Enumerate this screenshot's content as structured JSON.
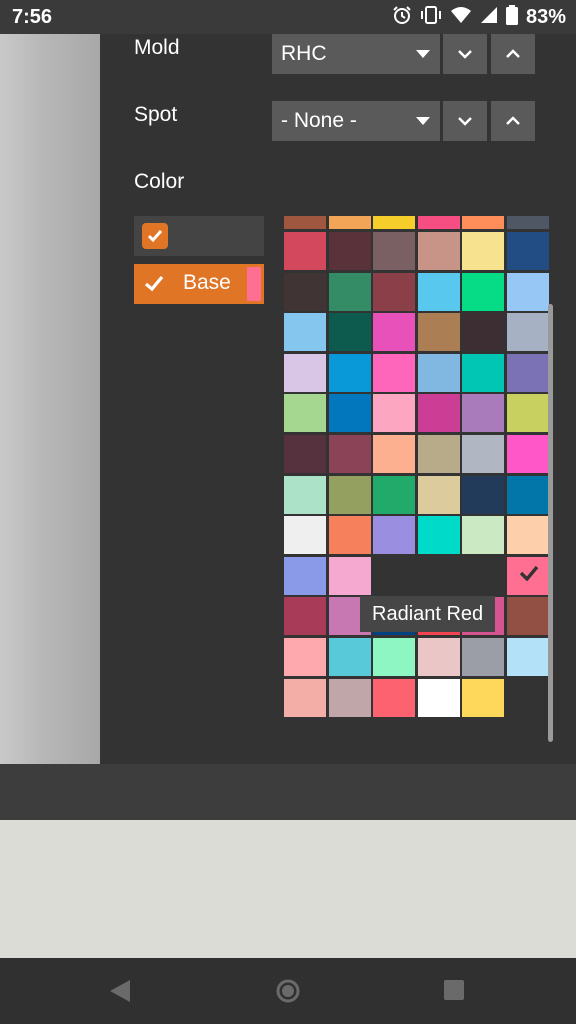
{
  "status_bar": {
    "time": "7:56",
    "battery_percent": "83%",
    "icons": [
      "alarm-icon",
      "vibrate-icon",
      "wifi-icon",
      "signal-icon",
      "battery-icon"
    ]
  },
  "controls": {
    "mold": {
      "label": "Mold",
      "value": "RHC"
    },
    "spot": {
      "label": "Spot",
      "value": "- None -"
    },
    "color": {
      "label": "Color"
    }
  },
  "layers": [
    {
      "label": "",
      "checked": true,
      "swatch_color": ""
    },
    {
      "label": "Base",
      "checked": true,
      "swatch_color": "#ff6f91"
    }
  ],
  "palette": {
    "partial_top_row": [
      "#a0573f",
      "#f2a556",
      "#f6ce2b",
      "#f64e82",
      "#ff8e5a",
      "#4f5664"
    ],
    "rows": [
      [
        "#d4485e",
        "#5a3239",
        "#7a6063",
        "#c79487",
        "#f7e38f",
        "#214d84"
      ],
      [
        "#403534",
        "#348c66",
        "#8a3f49",
        "#59c8ef",
        "#06dc86",
        "#97c7f5"
      ],
      [
        "#84c6ee",
        "#0d5a4e",
        "#e851b9",
        "#ab7e54",
        "#3c2e33",
        "#a6b2c4"
      ],
      [
        "#d9c6e6",
        "#0998d8",
        "#fd66bb",
        "#80b8e1",
        "#01c6b4",
        "#7b72b6"
      ],
      [
        "#a6d790",
        "#0377bd",
        "#fca6c1",
        "#cc3e95",
        "#a97bbb",
        "#c8d160"
      ],
      [
        "#56313e",
        "#8b4457",
        "#fdb08f",
        "#b8ab8a",
        "#b0b7c2",
        "#ff56c8"
      ],
      [
        "#ace3c8",
        "#94a05f",
        "#22aa6a",
        "#dccb9d",
        "#233b5a",
        "#0276a9"
      ],
      [
        "#efefef",
        "#f7805c",
        "#9a8ee0",
        "#00dac8",
        "#cbe9c3",
        "#fdcfaa"
      ],
      [
        "#8a9ae9",
        "#f5a9d1",
        "#",
        "#",
        "#",
        "#ff6f91"
      ],
      [
        "#a83c58",
        "#c777b1",
        "#014282",
        "#f3434e",
        "#d45590",
        "#925044"
      ],
      [
        "#fda9ae",
        "#58c9d8",
        "#8ef6c3",
        "#ebc6c6",
        "#9b9ea7",
        "#b3e2f8"
      ],
      [
        "#f3aea7",
        "#c0a6a9",
        "#fd6271",
        "#ffffff",
        "#fdd85b",
        ""
      ]
    ],
    "selected_row": 8,
    "selected_col": 5,
    "tooltip": "Radiant Red"
  },
  "nav": {
    "icons": [
      "back-icon",
      "home-icon",
      "recents-icon"
    ]
  },
  "colors": {
    "accent": "#e07526"
  }
}
